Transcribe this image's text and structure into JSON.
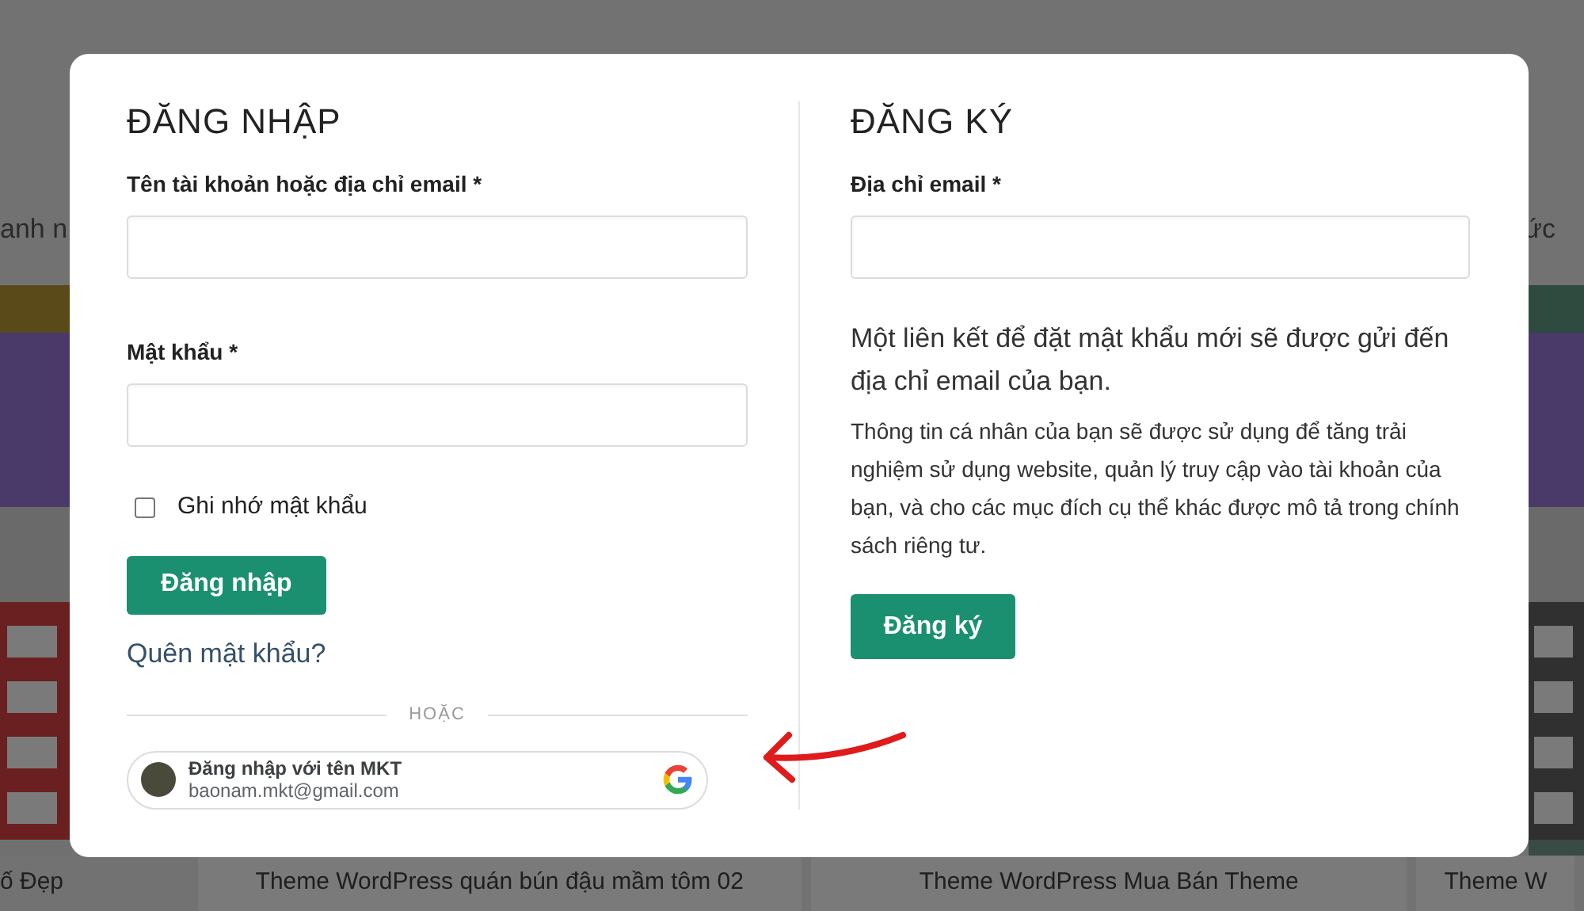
{
  "background": {
    "side_texts": [
      "anh n",
      "ức"
    ],
    "card_titles": [
      "ố Đẹp",
      "Theme WordPress quán bún đậu mầm tôm 02",
      "Theme WordPress Mua Bán Theme",
      "Theme W"
    ]
  },
  "login": {
    "title": "ĐĂNG NHẬP",
    "fields": [
      {
        "label": "Tên tài khoản hoặc địa chỉ email *"
      },
      {
        "label": "Mật khẩu *"
      }
    ],
    "remember": {
      "label": "Ghi nhớ mật khẩu",
      "checked": false
    },
    "button": "Đăng nhập",
    "forgot_link": "Quên mật khẩu?",
    "divider": "HOẶC",
    "google": {
      "name": "Đăng nhập với tên MKT",
      "email": "baonam.mkt@gmail.com"
    }
  },
  "register": {
    "title": "ĐĂNG KÝ",
    "fields": [
      {
        "label": "Địa chỉ email *"
      }
    ],
    "note": "Một liên kết để đặt mật khẩu mới sẽ được gửi đến địa chỉ email của bạn.",
    "privacy": "Thông tin cá nhân của bạn sẽ được sử dụng để tăng trải nghiệm sử dụng website, quản lý truy cập vào tài khoản của bạn, và cho các mục đích cụ thể khác được mô tả trong chính sách riêng tư.",
    "button": "Đăng ký"
  }
}
